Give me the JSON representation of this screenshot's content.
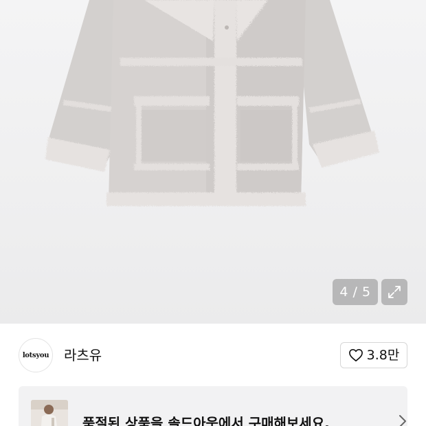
{
  "gallery": {
    "image_description_icon": "coat-product-photo",
    "counter": {
      "current": "4",
      "separator": "/",
      "total": "5"
    },
    "expand_icon": "expand-icon"
  },
  "seller": {
    "avatar_text": "lotsyou",
    "name": "라츠유",
    "like_icon": "heart-outline-icon",
    "like_count": "3.8만"
  },
  "banner": {
    "message": "품절된 상품을 솔드아웃에서 구매해보세요.",
    "chevron_icon": "chevron-right-icon"
  },
  "colors": {
    "badge_bg": "#8c8c8c",
    "banner_bg": "#f2f2f3",
    "coat": "#d2cecc",
    "text": "#111111"
  }
}
